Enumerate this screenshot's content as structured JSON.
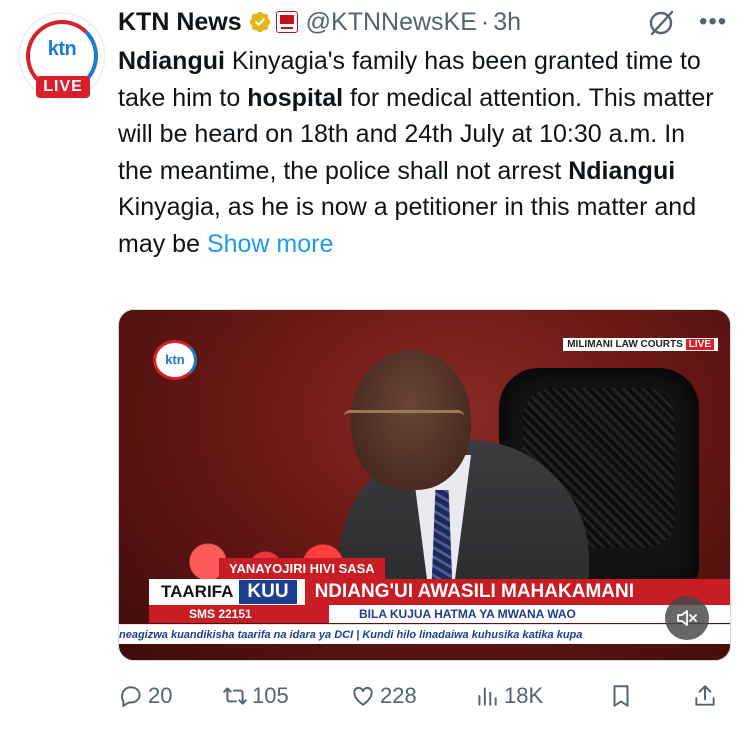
{
  "tweet": {
    "author_name": "KTN News",
    "handle": "@KTNNewsKE",
    "separator": "·",
    "time": "3h",
    "avatar": {
      "text_top": "ktn",
      "text_bottom": "LIVE"
    },
    "icons": {
      "verified": "verified-badge-icon",
      "affiliate": "standard-group-affiliate-icon",
      "grok": "grok-icon",
      "more": "more-options-icon"
    },
    "body": [
      {
        "text": "Ndiangui",
        "bold": true
      },
      {
        "text": " Kinyagia's family has been granted time to take him to ",
        "bold": false
      },
      {
        "text": "hospital",
        "bold": true
      },
      {
        "text": " for medical attention. This matter will be heard on 18th and 24th July at 10:30 a.m. In the meantime, the police shall not arrest ",
        "bold": false
      },
      {
        "text": "Ndiangui",
        "bold": true
      },
      {
        "text": " Kinyagia, as he is now a petitioner in this matter and may be ",
        "bold": false
      }
    ],
    "show_more": "Show more"
  },
  "media": {
    "logo": "ktn",
    "live_tag": "MILIMANI LAW COURTS",
    "live_label": "LIVE",
    "breaking": "YANAYOJIRI HIVI SASA",
    "taarifa": "TAARIFA",
    "kuu": "KUU",
    "headline": "NDIANG'UI AWASILI MAHAKAMANI",
    "sms": "SMS 22151",
    "subheadline": "BILA KUJUA HATMA YA MWANA WAO",
    "ticker": "neagizwa kuandikisha taarifa na idara ya DCI  |  Kundi hilo linadaiwa kuhusika katika kupa",
    "mute_icon": "muted-speaker-icon"
  },
  "actions": {
    "replies": "20",
    "reposts": "105",
    "likes": "228",
    "views": "18K"
  },
  "colors": {
    "link": "#1d9bf0",
    "muted_text": "#536471",
    "ktn_red": "#d81f2a",
    "ktn_blue": "#1b7bd1",
    "verified_gold": "#e2b719"
  }
}
